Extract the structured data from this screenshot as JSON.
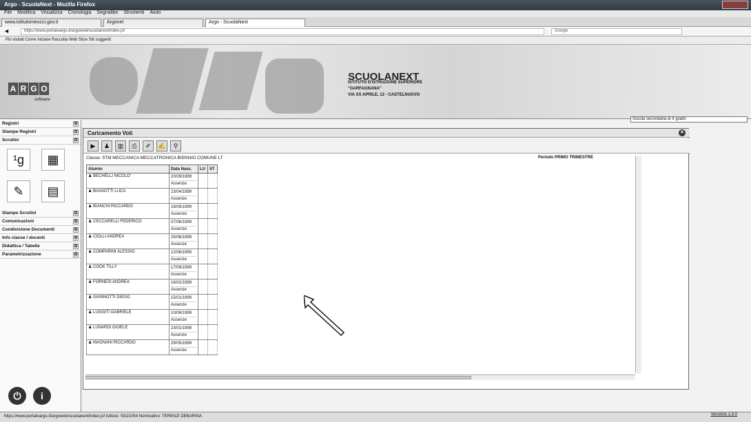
{
  "browser": {
    "title": "Argo - ScuolaNext - Mozilla Firefox",
    "menu": [
      "File",
      "Modifica",
      "Visualizza",
      "Cronologia",
      "Segnalibri",
      "Strumenti",
      "Aiuto"
    ],
    "tabs": [
      "www.istitutomeucci.gov.it",
      "Argonet",
      "Argo - ScuolaNext"
    ],
    "url": "https://www.portaleargo.it/argoweb/scuolanext/index.jsf",
    "search_placeholder": "Google",
    "bookmarks": "Più visitati   Come iniziare   Raccolta Web Slice   Siti suggeriti"
  },
  "banner": {
    "logo_letters": [
      "A",
      "R",
      "G",
      "O"
    ],
    "logo_sub": "software",
    "product": "SCUOLANEXT",
    "school_lines": [
      "ISTITUTO D'ISTRUZIONE SUPERIORE",
      "\"GARFAGNANA\"",
      "VIA XX APRILE, 12 - CASTELNUOVO"
    ],
    "school_type": "Scuola secondaria di II grado"
  },
  "sidebar": {
    "sections": [
      {
        "label": "Registri",
        "toggle": "⊟"
      },
      {
        "label": "Stampe Registri",
        "toggle": "⊟"
      },
      {
        "label": "Scrutini",
        "toggle": "⊟"
      }
    ],
    "sections2": [
      {
        "label": "Stampe Scrutini",
        "toggle": "⊟"
      },
      {
        "label": "Comunicazioni",
        "toggle": "⊟"
      },
      {
        "label": "Condivisione Documenti",
        "toggle": "⊟"
      },
      {
        "label": "Info classe / docenti",
        "toggle": "⊟"
      },
      {
        "label": "Didattica / Tabelle",
        "toggle": "⊟"
      },
      {
        "label": "Parametrizzazione",
        "toggle": "⊟"
      }
    ]
  },
  "main": {
    "title": "Caricamento Voti",
    "classe": "Classe: 5TM MECCANICA MECCATRONICA BIENNIO COMUNE LT",
    "periodo": "Periodo PRIMO TRIMESTRE",
    "headers": [
      "Alunno",
      "Data Nasc.",
      "LU",
      "ST"
    ],
    "absence_label": "Assenze",
    "students": [
      {
        "name": "BECHELLI NICOLO'",
        "date": "20/09/1999"
      },
      {
        "name": "BIAGIOTTI LUCA",
        "date": "23/04/1999"
      },
      {
        "name": "BIANCHI RICCARDO",
        "date": "18/09/1999"
      },
      {
        "name": "CECCARELLI FEDERICO",
        "date": "07/06/1999"
      },
      {
        "name": "CIOLLI ANDREA",
        "date": "25/08/1999"
      },
      {
        "name": "COMPARINI ALESSIO",
        "date": "12/06/1999"
      },
      {
        "name": "COOK TILLY",
        "date": "17/09/1999"
      },
      {
        "name": "FORNESI ANDREA",
        "date": "16/02/1999"
      },
      {
        "name": "GIANNOTTI DIEGO",
        "date": "15/01/1999"
      },
      {
        "name": "LUGGITI GABRIELE",
        "date": "10/09/1999"
      },
      {
        "name": "LUNARDI GIOELE",
        "date": "23/01/1999"
      },
      {
        "name": "MAGNANI RICCARDO",
        "date": "29/05/1999"
      }
    ]
  },
  "status": {
    "text": "https://www.portaleargo.it/argoweb/scuolanext/index.jsf  Istituto: SG21054  Nominativo: TERENZI DEBARINA",
    "version": "Versione 1.9.0"
  }
}
